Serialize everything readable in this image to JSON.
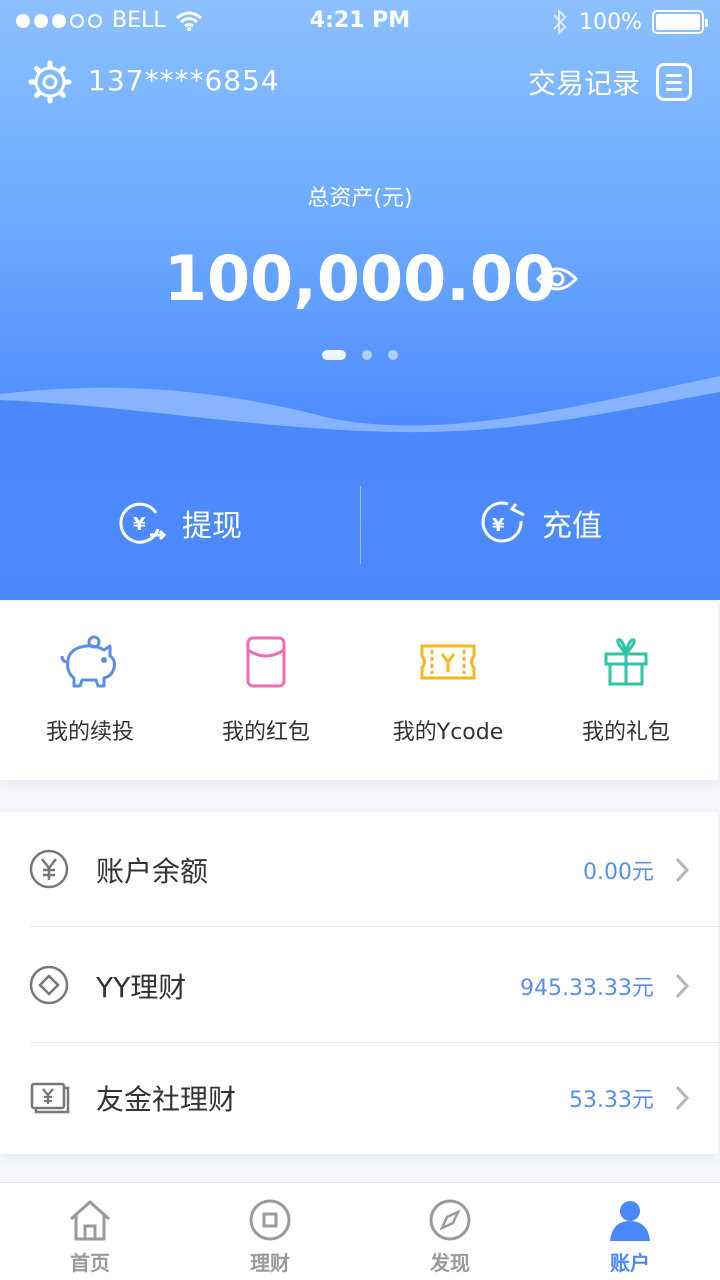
{
  "status_bar": {
    "carrier": "BELL",
    "time": "4:21 PM",
    "battery": "100%",
    "signal_filled": 3,
    "signal_total": 5
  },
  "header": {
    "phone": "137****6854",
    "records_label": "交易记录"
  },
  "assets": {
    "label": "总资产(元)",
    "value": "100,000.00"
  },
  "pager": {
    "count": 3,
    "active": 0
  },
  "actions": [
    {
      "label": "提现"
    },
    {
      "label": "充值"
    }
  ],
  "quick_links": [
    {
      "label": "我的续投",
      "icon": "piggy-bank-icon",
      "color": "#5b8fe6"
    },
    {
      "label": "我的红包",
      "icon": "red-envelope-icon",
      "color": "#f06bb0"
    },
    {
      "label": "我的Ycode",
      "icon": "ticket-icon",
      "color": "#f5b51b"
    },
    {
      "label": "我的礼包",
      "icon": "gift-icon",
      "color": "#2ec4a6"
    }
  ],
  "accounts": [
    {
      "label": "账户余额",
      "value": "0.00元",
      "icon": "yuan-circle-icon"
    },
    {
      "label": "YY理财",
      "value": "945.33.33元",
      "icon": "diamond-circle-icon"
    },
    {
      "label": "友金社理财",
      "value": "53.33元",
      "icon": "banknote-icon"
    }
  ],
  "tabs": [
    {
      "label": "首页",
      "icon": "home-icon"
    },
    {
      "label": "理财",
      "icon": "finance-icon"
    },
    {
      "label": "发现",
      "icon": "compass-icon"
    },
    {
      "label": "账户",
      "icon": "user-icon",
      "active": true
    }
  ],
  "colors": {
    "primary": "#4a88fb",
    "value_text": "#5b8fe6"
  }
}
